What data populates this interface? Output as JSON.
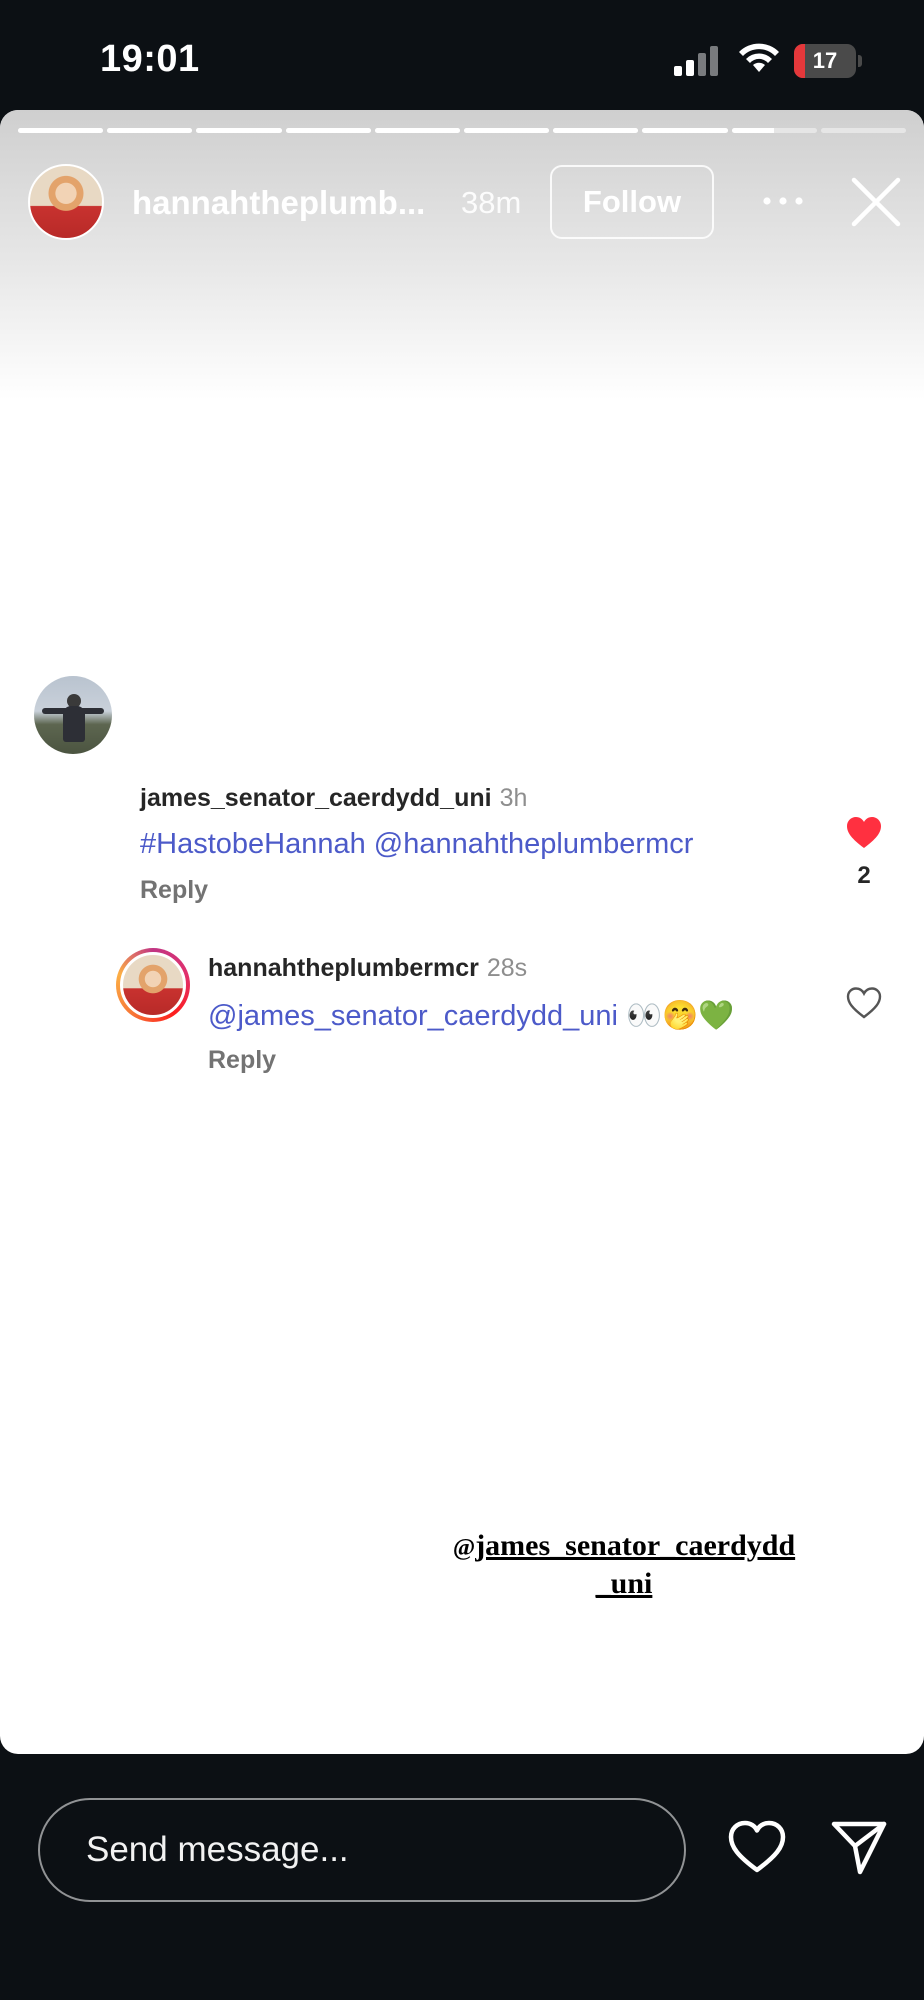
{
  "status_bar": {
    "time": "19:01",
    "battery_level": "17",
    "battery_color": "#e5383b",
    "icons": [
      "cellular-signal-icon",
      "wifi-icon",
      "battery-icon"
    ]
  },
  "story": {
    "progress_segments_total": 10,
    "progress_segments_viewed": 8.5,
    "username": "hannahtheplumb...",
    "posted_ago": "38m",
    "follow_label": "Follow",
    "icons": [
      "more-options-icon",
      "close-icon"
    ]
  },
  "comments": [
    {
      "username": "james_senator_caerdydd_uni",
      "time": "3h",
      "text": "#HastobeHannah @hannahtheplumbermcr",
      "reply_label": "Reply",
      "liked": true,
      "like_count": "2",
      "like_color": "#ff3040"
    },
    {
      "username": "hannahtheplumbermcr",
      "time": "28s",
      "mention": "@james_senator_caerdydd_uni",
      "emojis": "👀🤭💚",
      "reply_label": "Reply",
      "liked": false
    }
  ],
  "mention_sticker": {
    "at_symbol": "@",
    "line1": "james_senator_caerdydd",
    "line2": "_uni"
  },
  "bottom_bar": {
    "message_placeholder": "Send message...",
    "icons": [
      "heart-icon",
      "send-icon"
    ]
  },
  "colors": {
    "mention_blue": "#4c5ac9",
    "background_dark": "#0c1014"
  }
}
